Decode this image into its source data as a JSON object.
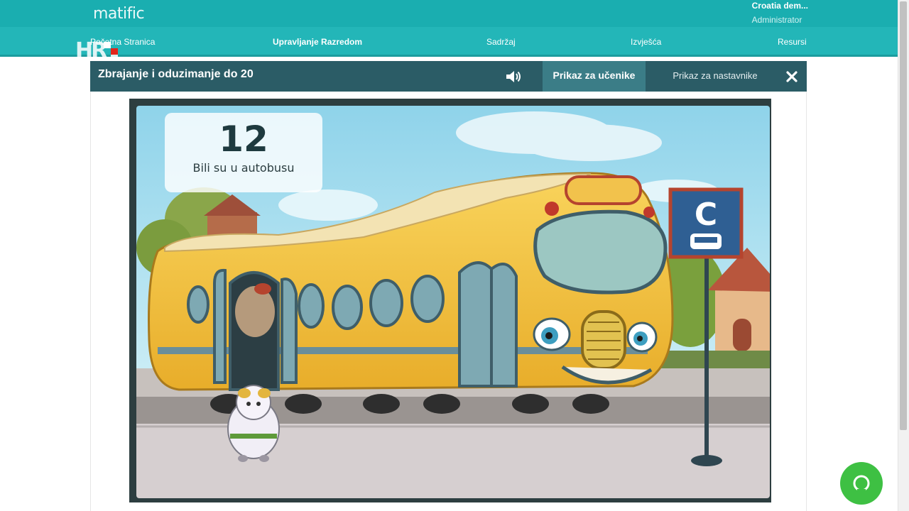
{
  "header": {
    "logo": "matific",
    "user_name": "Croatia dem...",
    "user_role": "Administrator"
  },
  "nav": {
    "items": [
      {
        "label": "Početna Stranica"
      },
      {
        "label": "Upravljanje Razredom",
        "bold": true
      },
      {
        "label": "Sadržaj"
      },
      {
        "label": "Izvješća"
      },
      {
        "label": "Resursi"
      }
    ]
  },
  "overlay_logo": "HRT",
  "modal": {
    "title": "Zbrajanje i oduzimanje do 20",
    "sound_icon": "speaker-icon",
    "tab_student": "Prikaz za učenike",
    "tab_teacher": "Prikaz za nastavnike",
    "close_icon": "close-icon"
  },
  "game": {
    "counter_value": "12",
    "counter_label": "Bili su u autobusu",
    "bus_stop_letter": "C"
  },
  "colors": {
    "header": "#1aaeb0",
    "nav": "#23b6b8",
    "modal_header": "#2b5c66",
    "active_tab": "#3b7d87",
    "help_button": "#3ec043"
  }
}
